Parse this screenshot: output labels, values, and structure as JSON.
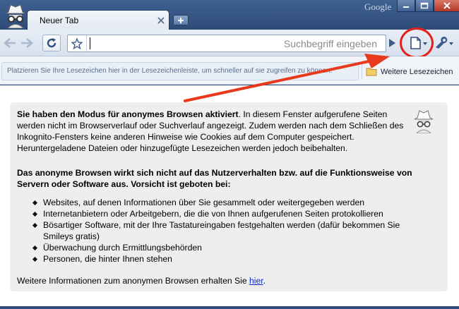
{
  "window": {
    "brand": "Google",
    "tab_title": "Neuer Tab"
  },
  "toolbar": {
    "omnibox_placeholder": "Suchbegriff eingeben"
  },
  "bookmarks": {
    "info_text": "Platzieren Sie Ihre Lesezeichen hier in der Lesezeichenleiste, um schneller auf sie zugreifen zu können.",
    "more_label": "Weitere Lesezeichen"
  },
  "incognito": {
    "intro_bold": "Sie haben den Modus für anonymes Browsen aktiviert",
    "intro_rest": ". In diesem Fenster aufgerufene Seiten werden nicht im Browserverlauf oder Suchverlauf angezeigt. Zudem werden nach dem Schließen des Inkognito-Fensters keine anderen Hinweise wie Cookies auf dem Computer gespeichert. Heruntergeladene Dateien oder hinzugefügte Lesezeichen werden jedoch beibehalten.",
    "warning": "Das anonyme Browsen wirkt sich nicht auf das Nutzerverhalten bzw. auf die Funktionsweise von Servern oder Software aus. Vorsicht ist geboten bei:",
    "bullets": [
      "Websites, auf denen Informationen über Sie gesammelt oder weitergegeben werden",
      "Internetanbietern oder Arbeitgebern, die die von Ihnen aufgerufenen Seiten protokollieren",
      "Bösartiger Software, mit der Ihre Tastatureingaben festgehalten werden (dafür bekommen Sie Smileys gratis)",
      "Überwachung durch Ermittlungsbehörden",
      "Personen, die hinter Ihnen stehen"
    ],
    "more_info_text": "Weitere Informationen zum anonymen Browsen erhalten Sie ",
    "more_info_link": "hier",
    "more_info_end": "."
  },
  "colors": {
    "frame": "#314d7a",
    "annotation": "#e3211b",
    "link": "#0b2bd1"
  },
  "icons": [
    "incognito-icon",
    "minimize-icon",
    "maximize-icon",
    "close-icon",
    "tab-close-icon",
    "new-tab-icon",
    "back-icon",
    "forward-icon",
    "reload-icon",
    "star-icon",
    "go-icon",
    "page-menu-icon",
    "wrench-icon",
    "folder-icon"
  ]
}
